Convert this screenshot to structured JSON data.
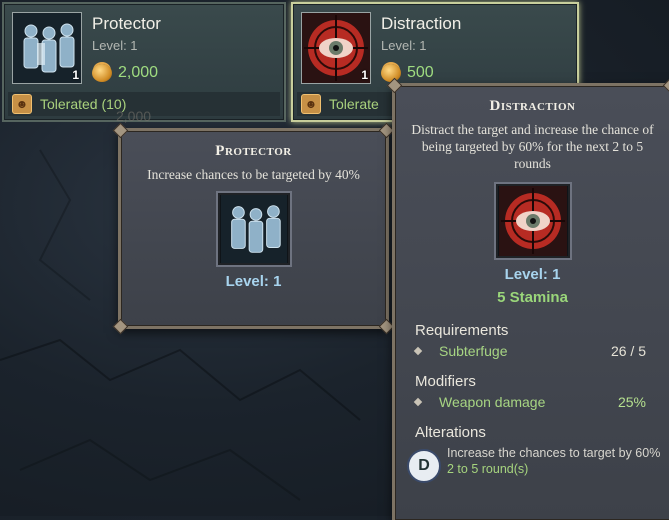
{
  "cards": [
    {
      "title": "Protector",
      "level_text": "Level: 1",
      "level_badge": "1",
      "cost": "2,000",
      "status": "Tolerated (10)",
      "icon": "shielded-soldiers-icon"
    },
    {
      "title": "Distraction",
      "level_text": "Level: 1",
      "level_badge": "1",
      "cost": "500",
      "status": "Tolerate",
      "icon": "eye-target-icon"
    }
  ],
  "ghost_cost": "2,000",
  "protector_tooltip": {
    "title": "Protector",
    "description": "Increase chances to be targeted by 40%",
    "level": "Level: 1"
  },
  "distraction_tooltip": {
    "title": "Distraction",
    "description": "Distract the target and increase the chance of being targeted by 60% for the next 2 to 5 rounds",
    "level": "Level: 1",
    "stamina": "5 Stamina",
    "requirements_title": "Requirements",
    "requirements": [
      {
        "name": "Subterfuge",
        "value": "26 / 5"
      }
    ],
    "modifiers_title": "Modifiers",
    "modifiers": [
      {
        "name": "Weapon damage",
        "value": "25%"
      }
    ],
    "alterations_title": "Alterations",
    "alteration": {
      "icon_letter": "D",
      "text": "Increase the chances to target by 60%",
      "duration": "2 to 5 round(s)"
    }
  },
  "colors": {
    "cost_green": "#9fdc80",
    "level_blue": "#a8d4ee",
    "selected_border": "#c8cf9c",
    "tooltip_frame": "#7d7364"
  }
}
